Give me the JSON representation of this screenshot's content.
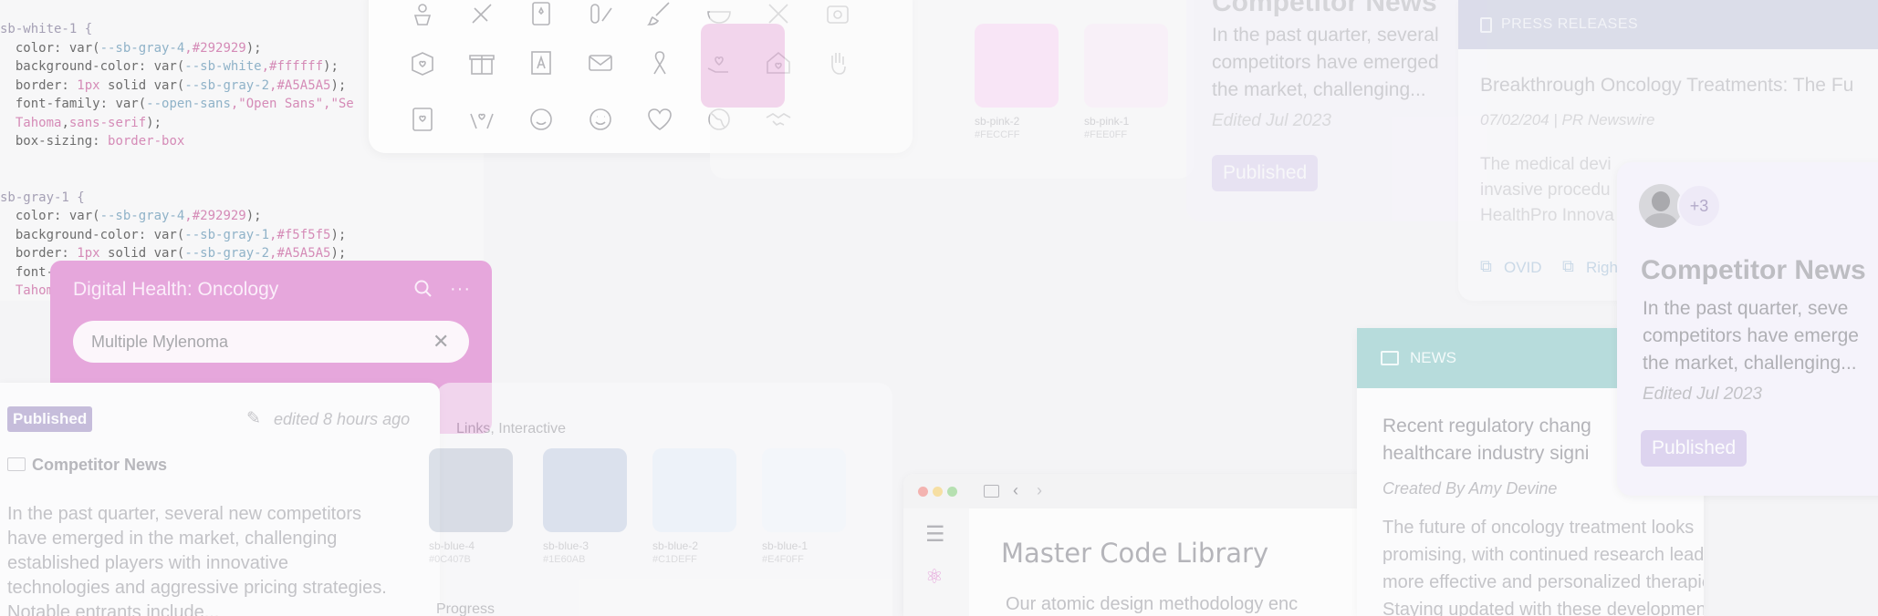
{
  "code": {
    "lines": [
      [
        {
          "t": "sb-white-1 {",
          "c": "c-sel"
        }
      ],
      [
        {
          "t": "  color: ",
          "c": "c-prop"
        },
        {
          "t": "var(",
          "c": "c-prop"
        },
        {
          "t": "--sb-gray-4",
          "c": "c-var"
        },
        {
          "t": ",#292929",
          "c": "c-val"
        },
        {
          "t": ");",
          "c": "c-prop"
        }
      ],
      [
        {
          "t": "  background-color: ",
          "c": "c-prop"
        },
        {
          "t": "var(",
          "c": "c-prop"
        },
        {
          "t": "--sb-white",
          "c": "c-var"
        },
        {
          "t": ",#ffffff",
          "c": "c-val"
        },
        {
          "t": ");",
          "c": "c-prop"
        }
      ],
      [
        {
          "t": "  border: ",
          "c": "c-prop"
        },
        {
          "t": "1px",
          "c": "c-val"
        },
        {
          "t": " solid ",
          "c": "c-prop"
        },
        {
          "t": "var(",
          "c": "c-prop"
        },
        {
          "t": "--sb-gray-2",
          "c": "c-var"
        },
        {
          "t": ",#A5A5A5",
          "c": "c-val"
        },
        {
          "t": ");",
          "c": "c-prop"
        }
      ],
      [
        {
          "t": "  font-family: ",
          "c": "c-prop"
        },
        {
          "t": "var(",
          "c": "c-prop"
        },
        {
          "t": "--open-sans",
          "c": "c-var"
        },
        {
          "t": ",\"Open Sans\",\"Se",
          "c": "c-str"
        }
      ],
      [
        {
          "t": "  Tahoma",
          "c": "c-str"
        },
        {
          "t": ",",
          "c": "c-prop"
        },
        {
          "t": "sans-serif",
          "c": "c-str"
        },
        {
          "t": ");",
          "c": "c-prop"
        }
      ],
      [
        {
          "t": "  box-sizing: ",
          "c": "c-prop"
        },
        {
          "t": "border-box",
          "c": "c-str"
        }
      ],
      [],
      [],
      [
        {
          "t": "sb-gray-1 {",
          "c": "c-sel"
        }
      ],
      [
        {
          "t": "  color: ",
          "c": "c-prop"
        },
        {
          "t": "var(",
          "c": "c-prop"
        },
        {
          "t": "--sb-gray-4",
          "c": "c-var"
        },
        {
          "t": ",#292929",
          "c": "c-val"
        },
        {
          "t": ");",
          "c": "c-prop"
        }
      ],
      [
        {
          "t": "  background-color: ",
          "c": "c-prop"
        },
        {
          "t": "var(",
          "c": "c-prop"
        },
        {
          "t": "--sb-gray-1",
          "c": "c-var"
        },
        {
          "t": ",#f5f5f5",
          "c": "c-val"
        },
        {
          "t": ");",
          "c": "c-prop"
        }
      ],
      [
        {
          "t": "  border: ",
          "c": "c-prop"
        },
        {
          "t": "1px",
          "c": "c-val"
        },
        {
          "t": " solid ",
          "c": "c-prop"
        },
        {
          "t": "var(",
          "c": "c-prop"
        },
        {
          "t": "--sb-gray-2",
          "c": "c-var"
        },
        {
          "t": ",#A5A5A5",
          "c": "c-val"
        },
        {
          "t": ");",
          "c": "c-prop"
        }
      ],
      [
        {
          "t": "  font-fa",
          "c": "c-prop"
        }
      ],
      [
        {
          "t": "  Tahoma,",
          "c": "c-str"
        }
      ]
    ]
  },
  "pink_swatches": [
    {
      "name": "sb-pink-2",
      "hex": "#FECCFF",
      "color": "#fdd9f7"
    },
    {
      "name": "sb-pink-1",
      "hex": "#FEE0FF",
      "color": "#fceefb"
    }
  ],
  "blue_section_label": "Links, Interactive",
  "blue_swatches": [
    {
      "name": "sb-blue-4",
      "hex": "#0C407B",
      "color": "#c2cad8"
    },
    {
      "name": "sb-blue-3",
      "hex": "#1E60AB",
      "color": "#c7d3e6"
    },
    {
      "name": "sb-blue-2",
      "hex": "#C1DEFF",
      "color": "#e8f2fc"
    },
    {
      "name": "sb-blue-1",
      "hex": "#E4F0FF",
      "color": "#f3f8fe"
    }
  ],
  "progress_label": "Progress",
  "competitor_top": {
    "title": "Competitor News",
    "desc_lines": [
      "In the past quarter, several",
      "competitors have emerged",
      "the market, challenging..."
    ],
    "edited": "Edited Jul 2023",
    "status": "Published"
  },
  "press": {
    "header": "PRESS RELEASES",
    "title": "Breakthrough Oncology Treatments: The Fu",
    "meta": "07/02/204 | PR Newswire",
    "body_lines": [
      "The medical devi",
      "invasive procedu",
      "HealthPro Innova"
    ],
    "links": [
      "OVID",
      "Righ"
    ]
  },
  "digital_health": {
    "title": "Digital Health: Oncology",
    "search_value": "Multiple Mylenoma"
  },
  "published_card": {
    "status": "Published",
    "edited": "edited 8 hours ago",
    "folder": "Competitor News",
    "body_lines": [
      "In the past quarter, several new competitors",
      "have emerged in the market, challenging",
      "established players with innovative",
      "technologies and aggressive pricing strategies.",
      "Notable entrants include..."
    ]
  },
  "browser": {
    "title": "Master Code Library",
    "body": "Our atomic design methodology enc"
  },
  "news": {
    "header": "NEWS",
    "title_lines": [
      "Recent regulatory chang",
      "healthcare industry signi"
    ],
    "created": "Created By Amy Devine",
    "body_lines": [
      "The future of oncology treatment looks",
      "promising, with continued research leading to",
      "more effective and personalized therapies.",
      "Staying updated with these developments is"
    ]
  },
  "competitor_right": {
    "avatar_count": "+3",
    "title": "Competitor News",
    "desc_lines": [
      "In the past quarter, seve",
      "competitors have emerge",
      "the market, challenging..."
    ],
    "edited": "Edited Jul 2023",
    "status": "Published"
  }
}
